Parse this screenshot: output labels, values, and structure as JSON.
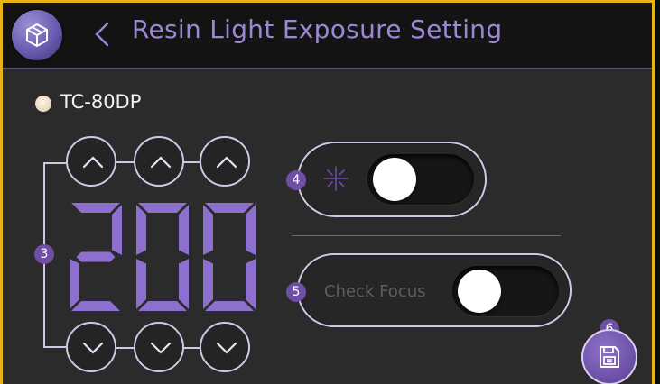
{
  "window": {
    "border_color": "#e7b319"
  },
  "header": {
    "title": "Resin Light Exposure Setting",
    "logo_icon": "cube-logo-icon",
    "back_icon": "chevron-left-icon",
    "accent": "#9b87d6"
  },
  "device": {
    "name": "TC-80DP",
    "status_color": "#e9d6bd"
  },
  "exposure": {
    "value": "200",
    "digits": [
      "2",
      "0",
      "0"
    ],
    "digit_color": "#8d6fd0",
    "up_icon": "chevron-up-icon",
    "down_icon": "chevron-down-icon",
    "badge": "3"
  },
  "light_toggle": {
    "badge": "4",
    "icon": "light-burst-icon",
    "state": "off"
  },
  "focus_toggle": {
    "badge": "5",
    "label": "Check Focus",
    "state": "off"
  },
  "save": {
    "badge": "6",
    "icon": "floppy-disk-icon"
  }
}
